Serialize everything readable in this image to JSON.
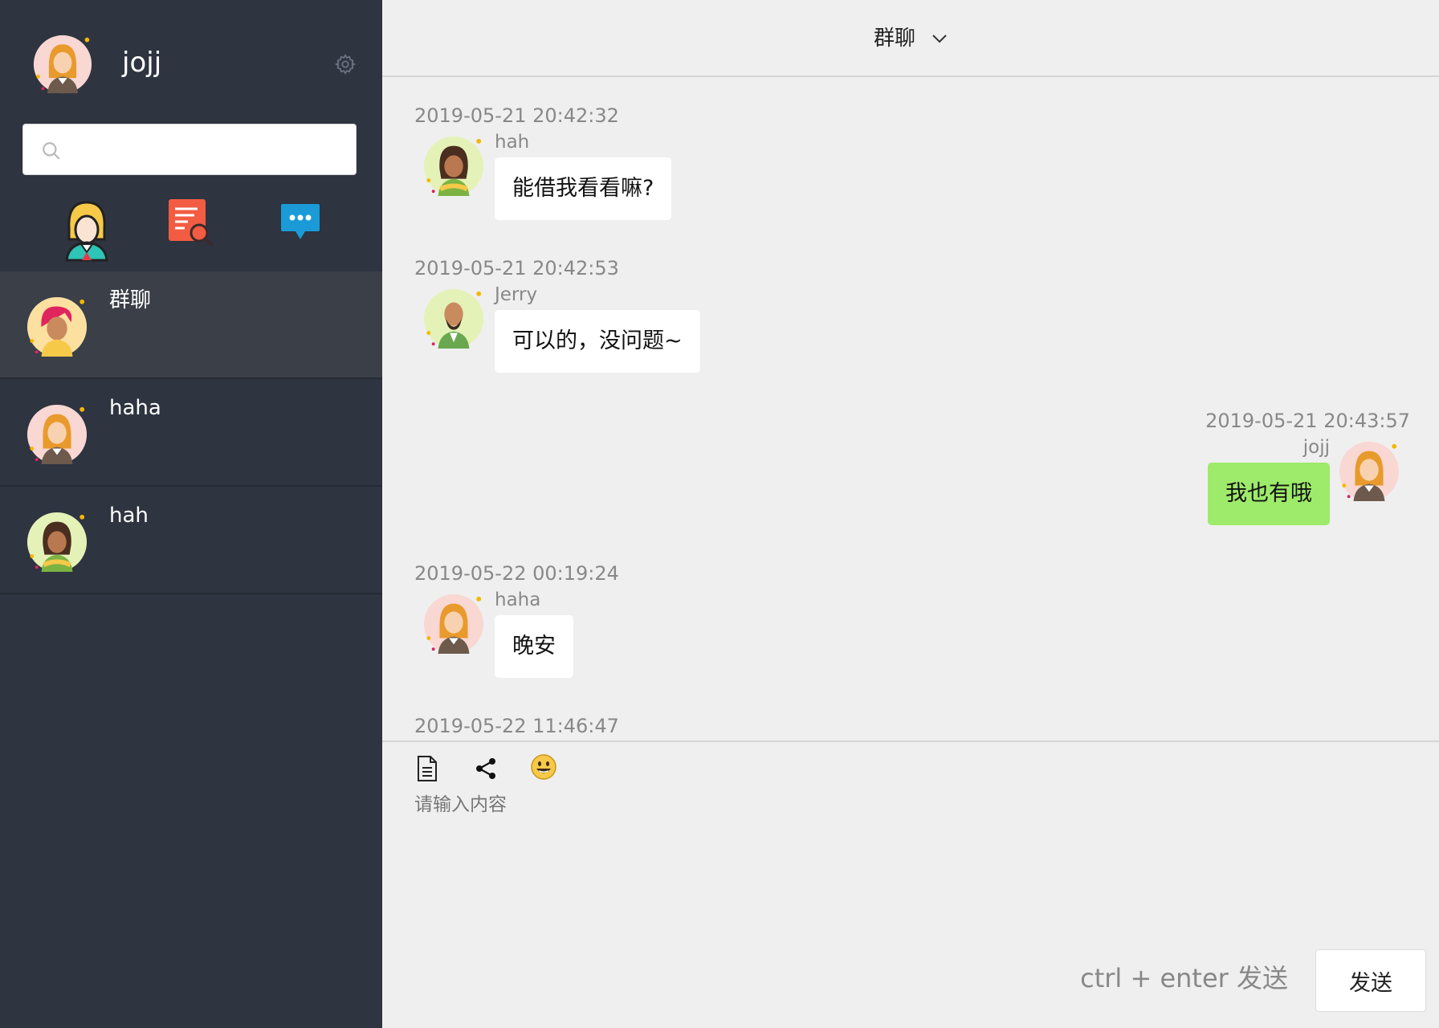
{
  "user": {
    "name": "jojj"
  },
  "search": {
    "placeholder": ""
  },
  "chat_list": [
    {
      "name": "群聊",
      "active": true
    },
    {
      "name": "haha",
      "active": false
    },
    {
      "name": "hah",
      "active": false
    }
  ],
  "header": {
    "title": "群聊"
  },
  "messages": [
    {
      "timestamp": "2019-05-21 20:42:32",
      "sender": "hah",
      "text": "能借我看看嘛?",
      "side": "left"
    },
    {
      "timestamp": "2019-05-21 20:42:53",
      "sender": "Jerry",
      "text": "可以的，没问题~",
      "side": "left"
    },
    {
      "timestamp": "2019-05-21 20:43:57",
      "sender": "jojj",
      "text": "我也有哦",
      "side": "right"
    },
    {
      "timestamp": "2019-05-22 00:19:24",
      "sender": "haha",
      "text": "晚安",
      "side": "left"
    },
    {
      "timestamp": "2019-05-22 11:46:47"
    }
  ],
  "composer": {
    "placeholder": "请输入内容",
    "hint": "ctrl + enter 发送",
    "send_label": "发送"
  },
  "icons": {
    "settings": "gear-icon",
    "search": "search-icon",
    "nav": [
      "user-icon",
      "document-search-icon",
      "chat-bubble-icon"
    ],
    "header": "chevron-down-icon",
    "toolbar": [
      "file-icon",
      "share-icon",
      "emoji-icon"
    ]
  },
  "colors": {
    "sidebar_bg": "#2e3440",
    "sidebar_active": "#3a3f48",
    "main_bg": "#efefef",
    "own_bubble": "#9eea6a",
    "other_bubble": "#ffffff"
  }
}
